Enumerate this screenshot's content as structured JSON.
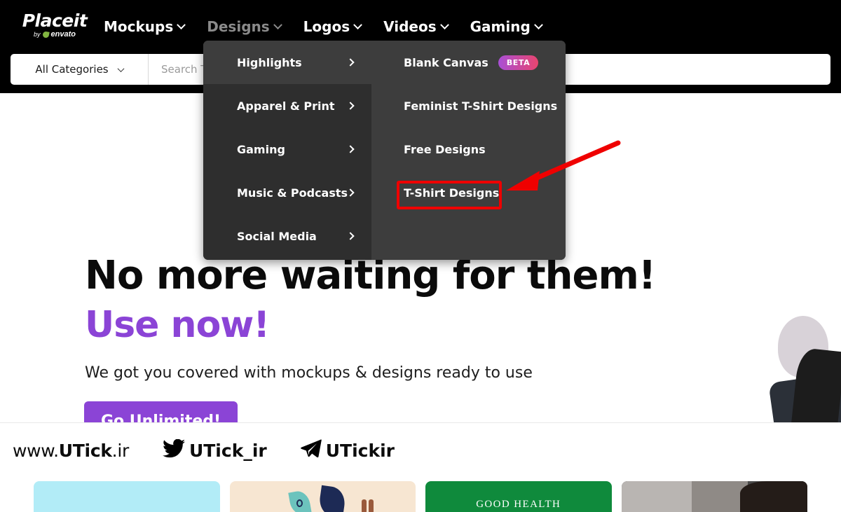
{
  "brand": {
    "logo_main": "Place",
    "logo_main_italic": "it",
    "logo_by": "by",
    "logo_envato": "envato"
  },
  "nav": {
    "items": [
      {
        "label": "Mockups",
        "dimmed": false,
        "icon": "chevron-down-icon"
      },
      {
        "label": "Designs",
        "dimmed": true,
        "icon": "chevron-down-icon"
      },
      {
        "label": "Logos",
        "dimmed": false,
        "icon": "chevron-down-icon"
      },
      {
        "label": "Videos",
        "dimmed": false,
        "icon": "chevron-down-icon"
      },
      {
        "label": "Gaming",
        "dimmed": false,
        "icon": "chevron-down-icon"
      }
    ]
  },
  "search": {
    "category_label": "All Categories",
    "category_icon": "chevron-down-icon",
    "placeholder": "Search T-Shirts, Logos, Mockups, Stories, Flyers...",
    "value": ""
  },
  "megamenu": {
    "left_items": [
      {
        "label": "Highlights",
        "active": true,
        "icon": "chevron-right-icon"
      },
      {
        "label": "Apparel & Print",
        "active": false,
        "icon": "chevron-right-icon"
      },
      {
        "label": "Gaming",
        "active": false,
        "icon": "chevron-right-icon"
      },
      {
        "label": "Music & Podcasts",
        "active": false,
        "icon": "chevron-right-icon"
      },
      {
        "label": "Social Media",
        "active": false,
        "icon": "chevron-right-icon"
      }
    ],
    "right_items": [
      {
        "label": "Blank Canvas",
        "badge": "BETA",
        "highlighted": false
      },
      {
        "label": "Feminist T-Shirt Designs",
        "badge": "",
        "highlighted": false
      },
      {
        "label": "Free Designs",
        "badge": "",
        "highlighted": false
      },
      {
        "label": "T-Shirt Designs",
        "badge": "",
        "highlighted": true
      }
    ]
  },
  "hero": {
    "heading_line1": "No more waiting for them!",
    "heading_line2": "Use now!",
    "subheading": "We got you covered with mockups & designs ready to use",
    "cta_label": "Go Unlimited!"
  },
  "watermark": {
    "site": "www.",
    "site_bold": "UTick",
    "site_tld": ".ir",
    "twitter_icon": "twitter-bird-icon",
    "twitter_handle": "UTick_ir",
    "telegram_icon": "telegram-paperplane-icon",
    "telegram_handle": "UTickir"
  },
  "cards": [
    {
      "name": "card-light-blue",
      "label": ""
    },
    {
      "name": "card-beige-designs",
      "label": ""
    },
    {
      "name": "card-green-good-health",
      "label": "GOOD HEALTH"
    },
    {
      "name": "card-photo",
      "label": ""
    }
  ],
  "annotation": {
    "highlight_color": "#ef0000",
    "arrow_color": "#ef0000",
    "target": "T-Shirt Designs"
  },
  "colors": {
    "header_bg": "#000000",
    "menu_bg": "#3d3d3d",
    "menu_left_bg": "#2e2e2e",
    "accent_purple": "#8b44d6",
    "beta_gradient_start": "#a94fd6",
    "beta_gradient_end": "#e8456f"
  }
}
